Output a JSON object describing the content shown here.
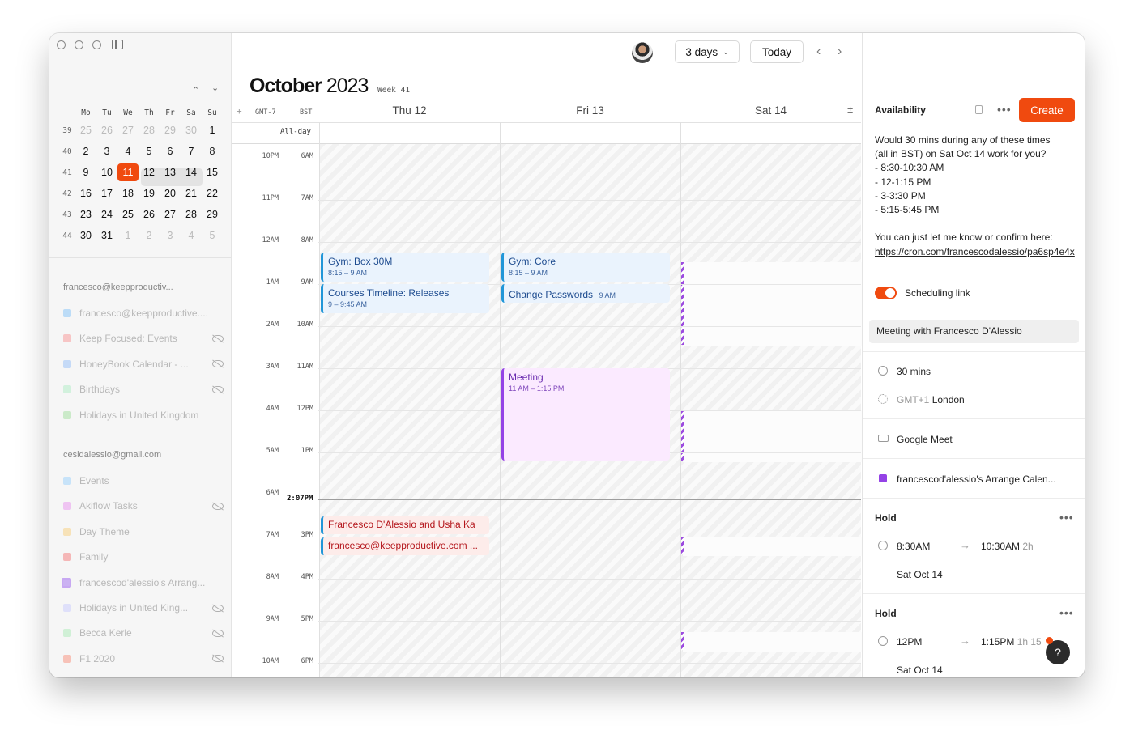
{
  "sidebar": {
    "mini_calendar": {
      "weekday_headers": [
        "Mo",
        "Tu",
        "We",
        "Th",
        "Fr",
        "Sa",
        "Su"
      ],
      "weeks": [
        {
          "num": "39",
          "days": [
            "25",
            "26",
            "27",
            "28",
            "29",
            "30",
            "1"
          ]
        },
        {
          "num": "40",
          "days": [
            "2",
            "3",
            "4",
            "5",
            "6",
            "7",
            "8"
          ]
        },
        {
          "num": "41",
          "days": [
            "9",
            "10",
            "11",
            "12",
            "13",
            "14",
            "15"
          ]
        },
        {
          "num": "42",
          "days": [
            "16",
            "17",
            "18",
            "19",
            "20",
            "21",
            "22"
          ]
        },
        {
          "num": "43",
          "days": [
            "23",
            "24",
            "25",
            "26",
            "27",
            "28",
            "29"
          ]
        },
        {
          "num": "44",
          "days": [
            "30",
            "31",
            "1",
            "2",
            "3",
            "4",
            "5"
          ]
        }
      ],
      "today": "11",
      "prev_glyph": "⌃",
      "next_glyph": "⌄"
    },
    "accounts": [
      {
        "email": "francesco@keepproductiv...",
        "calendars": [
          {
            "label": "francesco@keepproductive....",
            "color": "#bcdcf7",
            "hidden": false
          },
          {
            "label": "Keep Focused: Events",
            "color": "#f7c5c5",
            "hidden": true
          },
          {
            "label": "HoneyBook Calendar - ...",
            "color": "#c5daf7",
            "hidden": true
          },
          {
            "label": "Birthdays",
            "color": "#d2f1dd",
            "hidden": true
          },
          {
            "label": "Holidays in United Kingdom",
            "color": "#cbeac9",
            "hidden": false
          }
        ]
      },
      {
        "email": "cesidalessio@gmail.com",
        "calendars": [
          {
            "label": "Events",
            "color": "#c7e3f9",
            "hidden": false
          },
          {
            "label": "Akiflow Tasks",
            "color": "#efc4f2",
            "hidden": true
          },
          {
            "label": "Day Theme",
            "color": "#f7e2b8",
            "hidden": false
          },
          {
            "label": "Family",
            "color": "#f5b7b7",
            "hidden": false
          },
          {
            "label": "francescod'alessio's Arrang...",
            "color": "#cbb2f2",
            "hidden": false
          },
          {
            "label": "Holidays in United King...",
            "color": "#dfe0fa",
            "hidden": true
          },
          {
            "label": "Becca Kerle",
            "color": "#d0f0d6",
            "hidden": true
          },
          {
            "label": "F1 2020",
            "color": "#f7c2b8",
            "hidden": true
          }
        ]
      }
    ]
  },
  "toolbar": {
    "view_label": "3 days",
    "today_label": "Today",
    "prev_glyph": "‹",
    "next_glyph": "›"
  },
  "header": {
    "month": "October",
    "year": "2023",
    "week_label": "Week 41",
    "tz_left": "GMT-7",
    "tz_right": "BST",
    "add_tz_glyph": "+",
    "expand_glyph": "±",
    "days": [
      "Thu 12",
      "Fri 13",
      "Sat 14"
    ],
    "allday_label": "All-day"
  },
  "time_labels": [
    [
      "10PM",
      "6AM"
    ],
    [
      "11PM",
      "7AM"
    ],
    [
      "12AM",
      "8AM"
    ],
    [
      "1AM",
      "9AM"
    ],
    [
      "2AM",
      "10AM"
    ],
    [
      "3AM",
      "11AM"
    ],
    [
      "4AM",
      "12PM"
    ],
    [
      "5AM",
      "1PM"
    ],
    [
      "6AM",
      ""
    ],
    [
      "7AM",
      "3PM"
    ],
    [
      "8AM",
      "4PM"
    ],
    [
      "9AM",
      "5PM"
    ],
    [
      "10AM",
      "6PM"
    ]
  ],
  "now_label": "2:07PM",
  "events": {
    "gym_box": {
      "title": "Gym: Box 30M",
      "time": "8:15 – 9 AM"
    },
    "courses": {
      "title": "Courses Timeline: Releases",
      "time": "9 – 9:45 AM"
    },
    "gym_core": {
      "title": "Gym: Core",
      "time": "8:15 – 9 AM"
    },
    "passwords": {
      "title": "Change Passwords",
      "time": "9 AM"
    },
    "meeting": {
      "title": "Meeting",
      "time": "11 AM – 1:15 PM"
    },
    "usha": {
      "title": "Francesco D'Alessio and Usha Ka"
    },
    "fka": {
      "title": "francesco@keepproductive.com ..."
    }
  },
  "panel": {
    "availability_label": "Availability",
    "create_label": "Create",
    "more_glyph": "•••",
    "message_lines": [
      "Would 30 mins during any of these times",
      "(all in BST) on Sat Oct 14 work for you?",
      "- 8:30-10:30 AM",
      "- 12-1:15 PM",
      "- 3-3:30 PM",
      "- 5:15-5:45 PM",
      "",
      "You can just let me know or confirm here:"
    ],
    "link": "https://cron.com/francescodalessio/pa6sp4e4x",
    "scheduling_link_label": "Scheduling link",
    "meeting_title": "Meeting with Francesco D'Alessio",
    "duration": "30 mins",
    "tz_offset": "GMT+1",
    "tz_city": "London",
    "conferencing": "Google Meet",
    "calendar": "francescod'alessio's Arrange Calen...",
    "holds": [
      {
        "label": "Hold",
        "start": "8:30AM",
        "end": "10:30AM",
        "dur": "2h",
        "date": "Sat Oct 14"
      },
      {
        "label": "Hold",
        "start": "12PM",
        "end": "1:15PM",
        "dur": "1h 15",
        "date": "Sat Oct 14"
      }
    ],
    "help_glyph": "?"
  }
}
